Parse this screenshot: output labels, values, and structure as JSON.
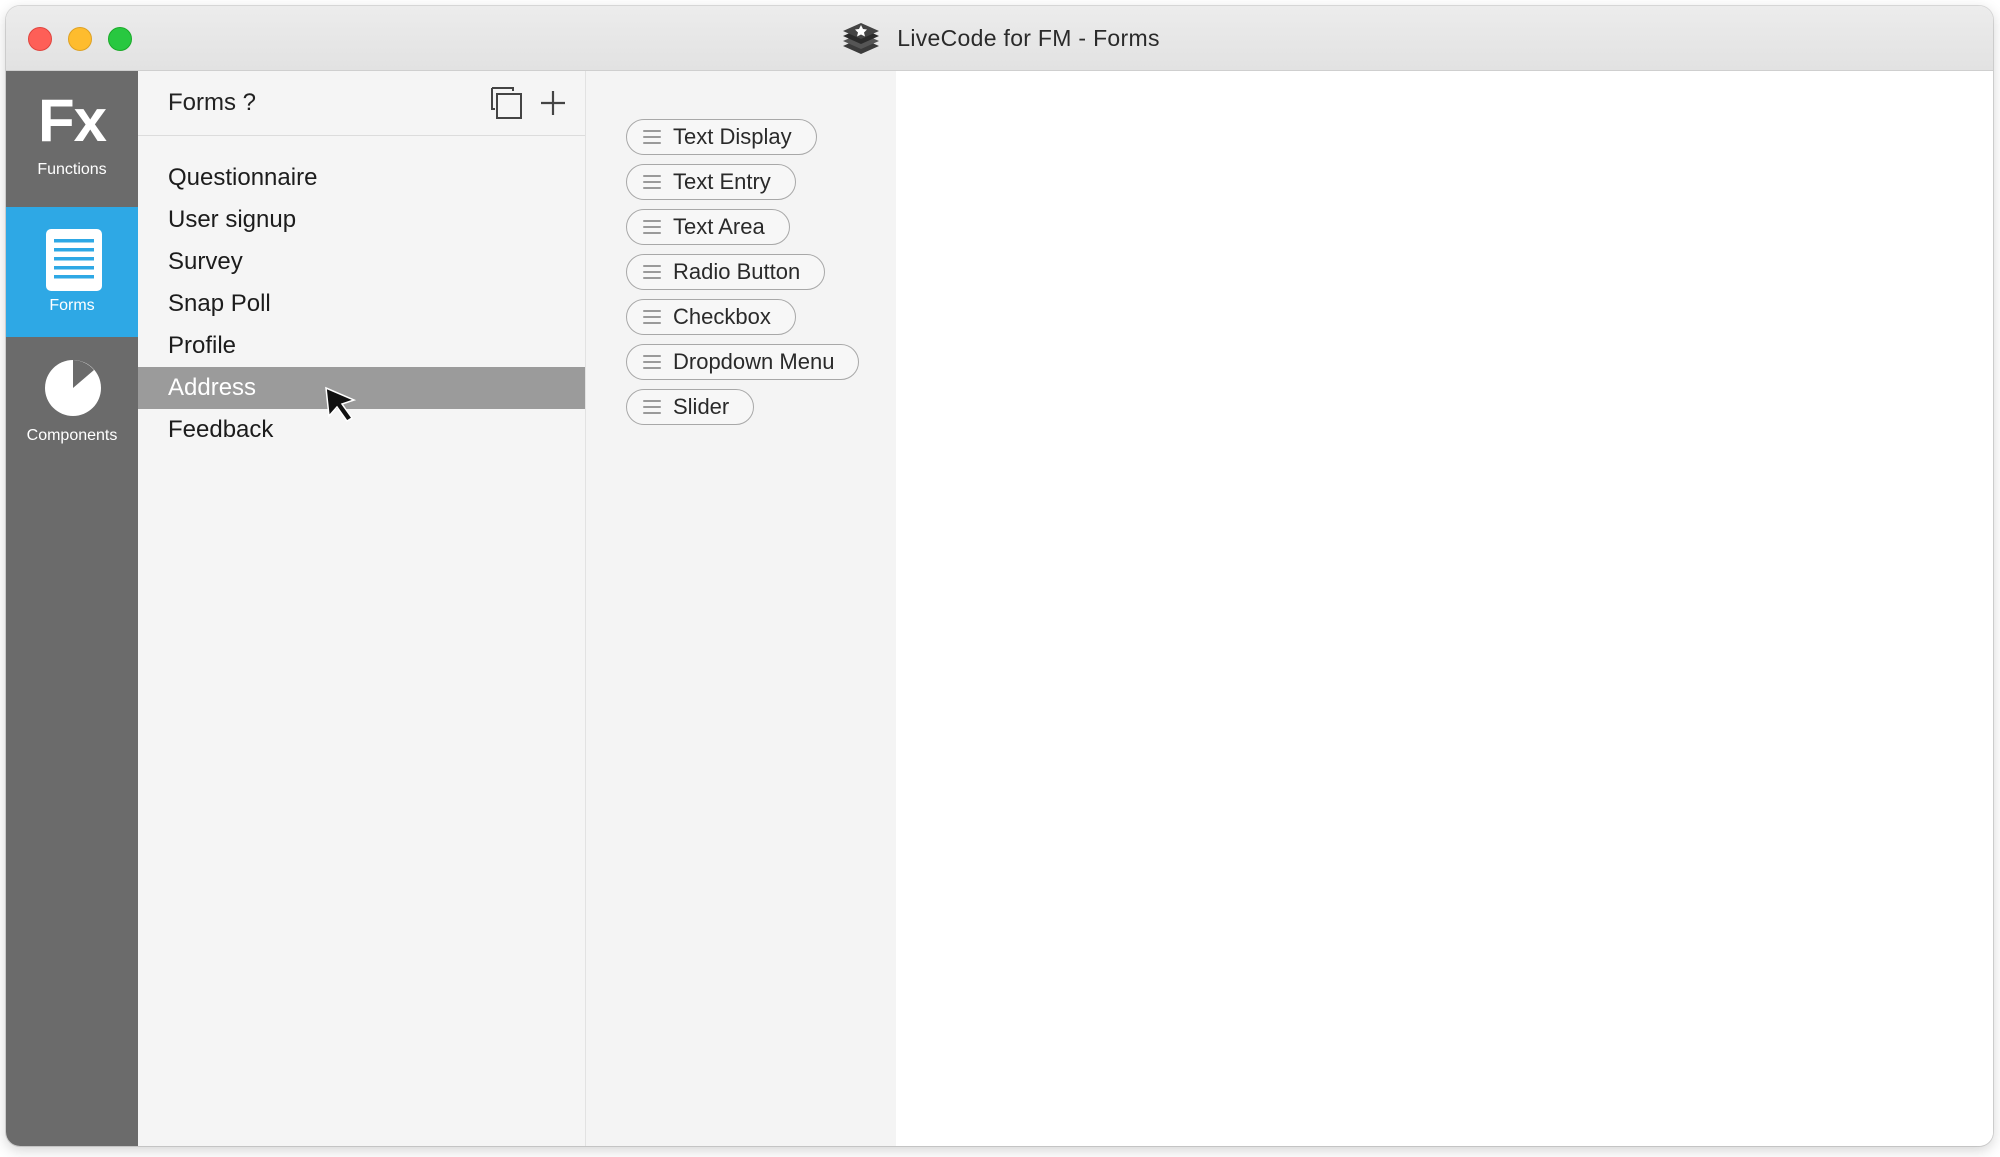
{
  "window": {
    "title": "LiveCode for FM - Forms"
  },
  "rail": {
    "items": [
      {
        "glyph": "Fx",
        "label": "Functions",
        "icon": "fx-icon"
      },
      {
        "label": "Forms",
        "icon": "document-icon",
        "active": true
      },
      {
        "label": "Components",
        "icon": "pie-icon"
      }
    ]
  },
  "forms": {
    "header": "Forms ?",
    "items": [
      "Questionnaire",
      "User signup",
      "Survey",
      "Snap Poll",
      "Profile",
      "Address",
      "Feedback"
    ],
    "selected": "Address"
  },
  "components": {
    "items": [
      "Text Display",
      "Text Entry",
      "Text Area",
      "Radio Button",
      "Checkbox",
      "Dropdown Menu",
      "Slider"
    ]
  },
  "colors": {
    "rail": "#6b6b6b",
    "active": "#2ea8e5",
    "selected_row": "#9b9b9b"
  }
}
